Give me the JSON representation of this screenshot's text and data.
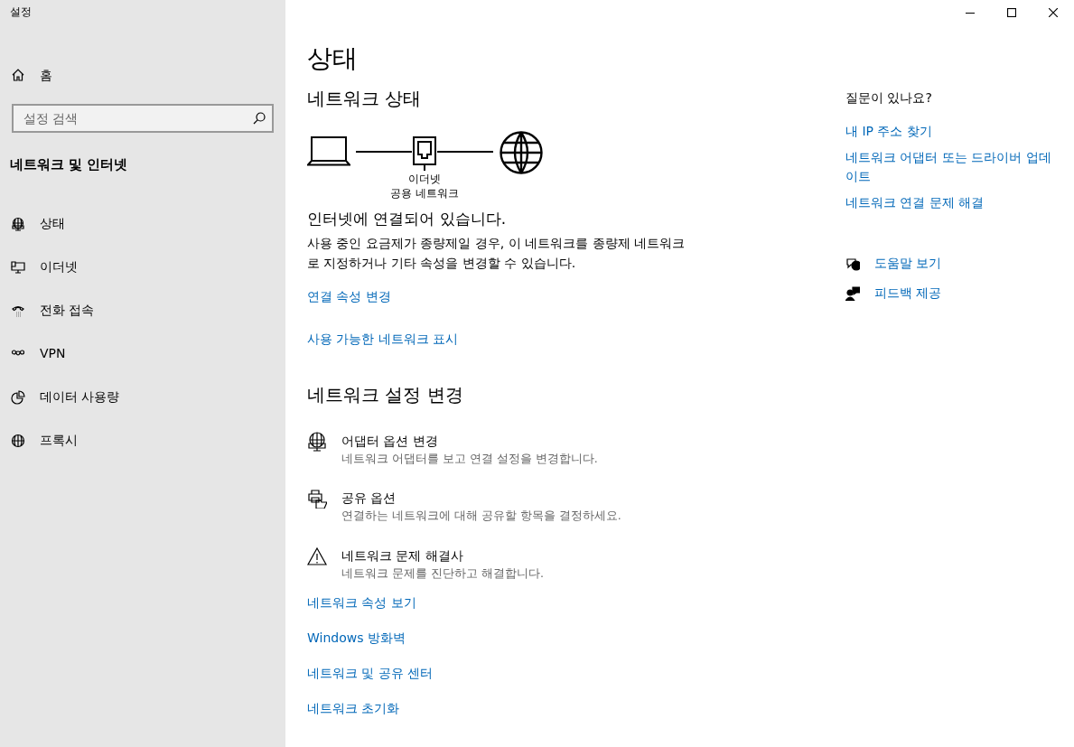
{
  "window": {
    "title": "설정"
  },
  "sidebar": {
    "home": "홈",
    "search": {
      "placeholder": "설정 검색"
    },
    "section": "네트워크 및 인터넷",
    "items": [
      {
        "label": "상태",
        "kind": "status"
      },
      {
        "label": "이더넷",
        "kind": "ethernet"
      },
      {
        "label": "전화 접속",
        "kind": "dialup"
      },
      {
        "label": "VPN",
        "kind": "vpn"
      },
      {
        "label": "데이터 사용량",
        "kind": "data"
      },
      {
        "label": "프록시",
        "kind": "proxy"
      }
    ]
  },
  "page": {
    "title": "상태",
    "network_status": {
      "heading": "네트워크 상태",
      "diagram": {
        "adapter": "이더넷",
        "network": "공용 네트워크"
      },
      "connected": "인터넷에 연결되어 있습니다.",
      "description": "사용 중인 요금제가 종량제일 경우, 이 네트워크를 종량제 네트워크로 지정하거나 기타 속성을 변경할 수 있습니다.",
      "links": [
        "연결 속성 변경",
        "사용 가능한 네트워크 표시"
      ]
    },
    "change_settings": {
      "heading": "네트워크 설정 변경",
      "items": [
        {
          "kind": "adapter",
          "title": "어댑터 옵션 변경",
          "description": "네트워크 어댑터를 보고 연결 설정을 변경합니다."
        },
        {
          "kind": "sharing",
          "title": "공유 옵션",
          "description": "연결하는 네트워크에 대해 공유할 항목을 결정하세요."
        },
        {
          "kind": "troubleshoot",
          "title": "네트워크 문제 해결사",
          "description": "네트워크 문제를 진단하고 해결합니다."
        }
      ],
      "links": [
        "네트워크 속성 보기",
        "Windows 방화벽",
        "네트워크 및 공유 센터",
        "네트워크 초기화"
      ]
    }
  },
  "aside": {
    "heading": "질문이 있나요?",
    "links": [
      "내 IP 주소 찾기",
      "네트워크 어댑터 또는 드라이버 업데이트",
      "네트워크 연결 문제 해결"
    ],
    "help": [
      {
        "kind": "help",
        "label": "도움말 보기"
      },
      {
        "kind": "feedback",
        "label": "피드백 제공"
      }
    ]
  }
}
